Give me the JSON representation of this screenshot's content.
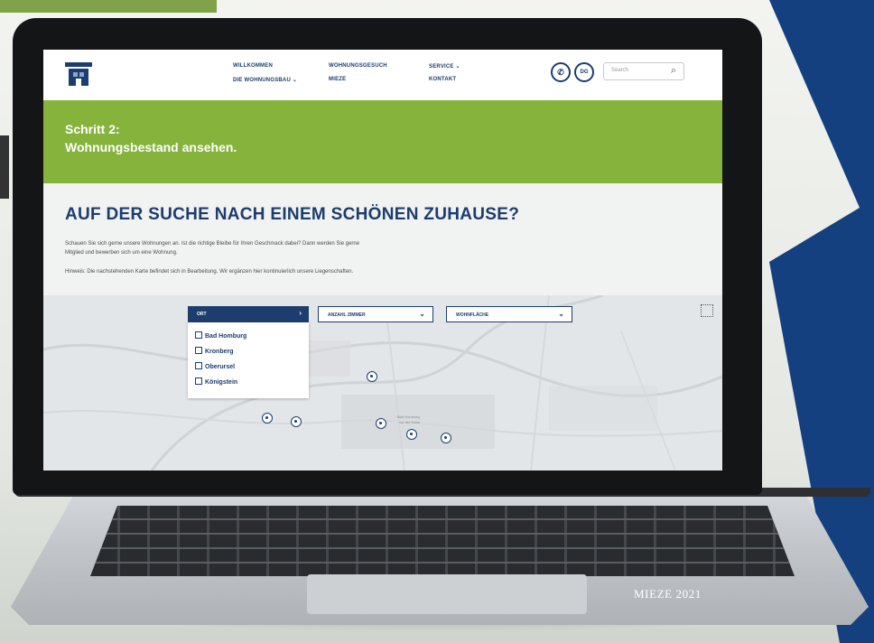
{
  "site": {
    "nav_items": [
      "WILLKOMMEN",
      "DIE WOHNUNGSBAU ⌄",
      "WOHNUNGSGESUCH",
      "MIEZE",
      "SERVICE ⌄",
      "KONTAKT"
    ],
    "search_placeholder": "Search",
    "hero_line1": "Schritt 2:",
    "hero_line2": "Wohnungsbestand ansehen.",
    "headline": "AUF DER SUCHE NACH EINEM SCHÖNEN ZUHAUSE?",
    "intro_line1": "Schauen Sie sich gerne unsere Wohnungen an. Ist die richtige Bleibe für Ihren Geschmack dabei? Dann werden Sie gerne",
    "intro_line2": "Mitglied und bewerben sich um eine Wohnung.",
    "hint": "Hinweis: Die nachstehenden Karte befindet sich in Bearbeitung. Wir ergänzen hier kontinuierlich unsere Liegenschaften."
  },
  "map": {
    "filters": [
      {
        "label": "ORT",
        "active": true
      },
      {
        "label": "ANZAHL ZIMMER",
        "active": false
      },
      {
        "label": "WOHNFLÄCHE",
        "active": false
      }
    ],
    "locations": [
      "Bad Homburg",
      "Kronberg",
      "Oberursel",
      "Königstein"
    ],
    "labels": [
      "Bad Homburg",
      "vor der Höhe"
    ]
  },
  "icons": [
    "logo-icon",
    "phone-icon",
    "sign-language-icon",
    "search-icon",
    "expand-icon",
    "map-pin-icon"
  ],
  "colors": {
    "brand_blue": "#1c3d6e",
    "green": "#86b33c",
    "panel_blue": "#15407f"
  },
  "caption": "MIEZE 2021"
}
